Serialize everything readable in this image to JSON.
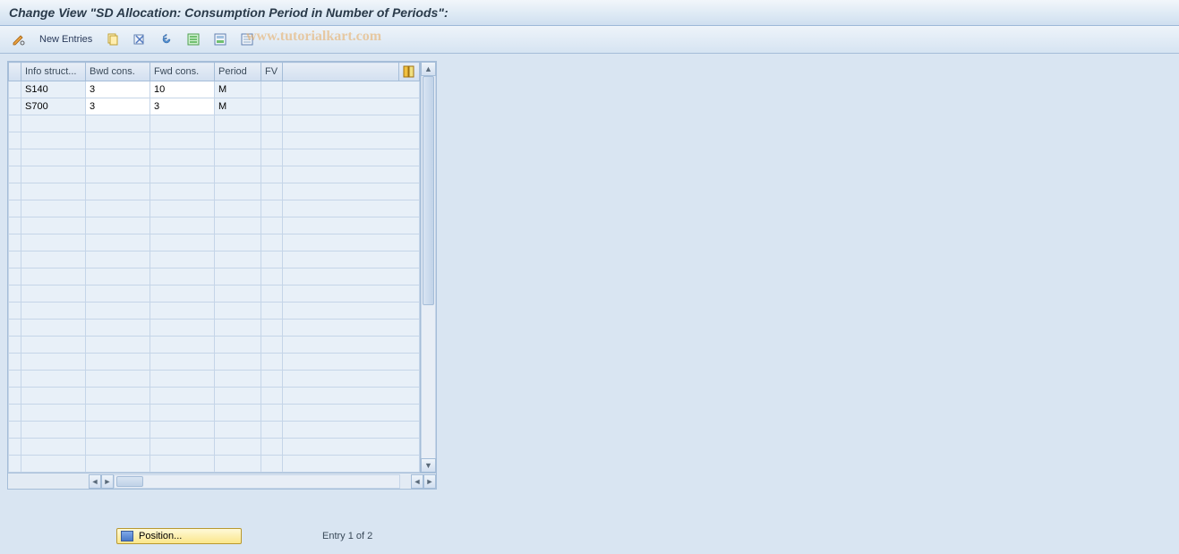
{
  "title": "Change View \"SD Allocation: Consumption Period in Number of Periods\":",
  "toolbar": {
    "new_entries_label": "New Entries"
  },
  "watermark": "www.tutorialkart.com",
  "table": {
    "columns": {
      "info_struct": "Info struct...",
      "bwd_cons": "Bwd cons.",
      "fwd_cons": "Fwd cons.",
      "period": "Period",
      "fv": "FV"
    },
    "rows": [
      {
        "info_struct": "S140",
        "bwd_cons": "3",
        "fwd_cons": "10",
        "period": "M",
        "fv": ""
      },
      {
        "info_struct": "S700",
        "bwd_cons": "3",
        "fwd_cons": "3",
        "period": "M",
        "fv": ""
      }
    ],
    "empty_rows": 21
  },
  "footer": {
    "position_label": "Position...",
    "entry_status": "Entry 1 of 2"
  }
}
